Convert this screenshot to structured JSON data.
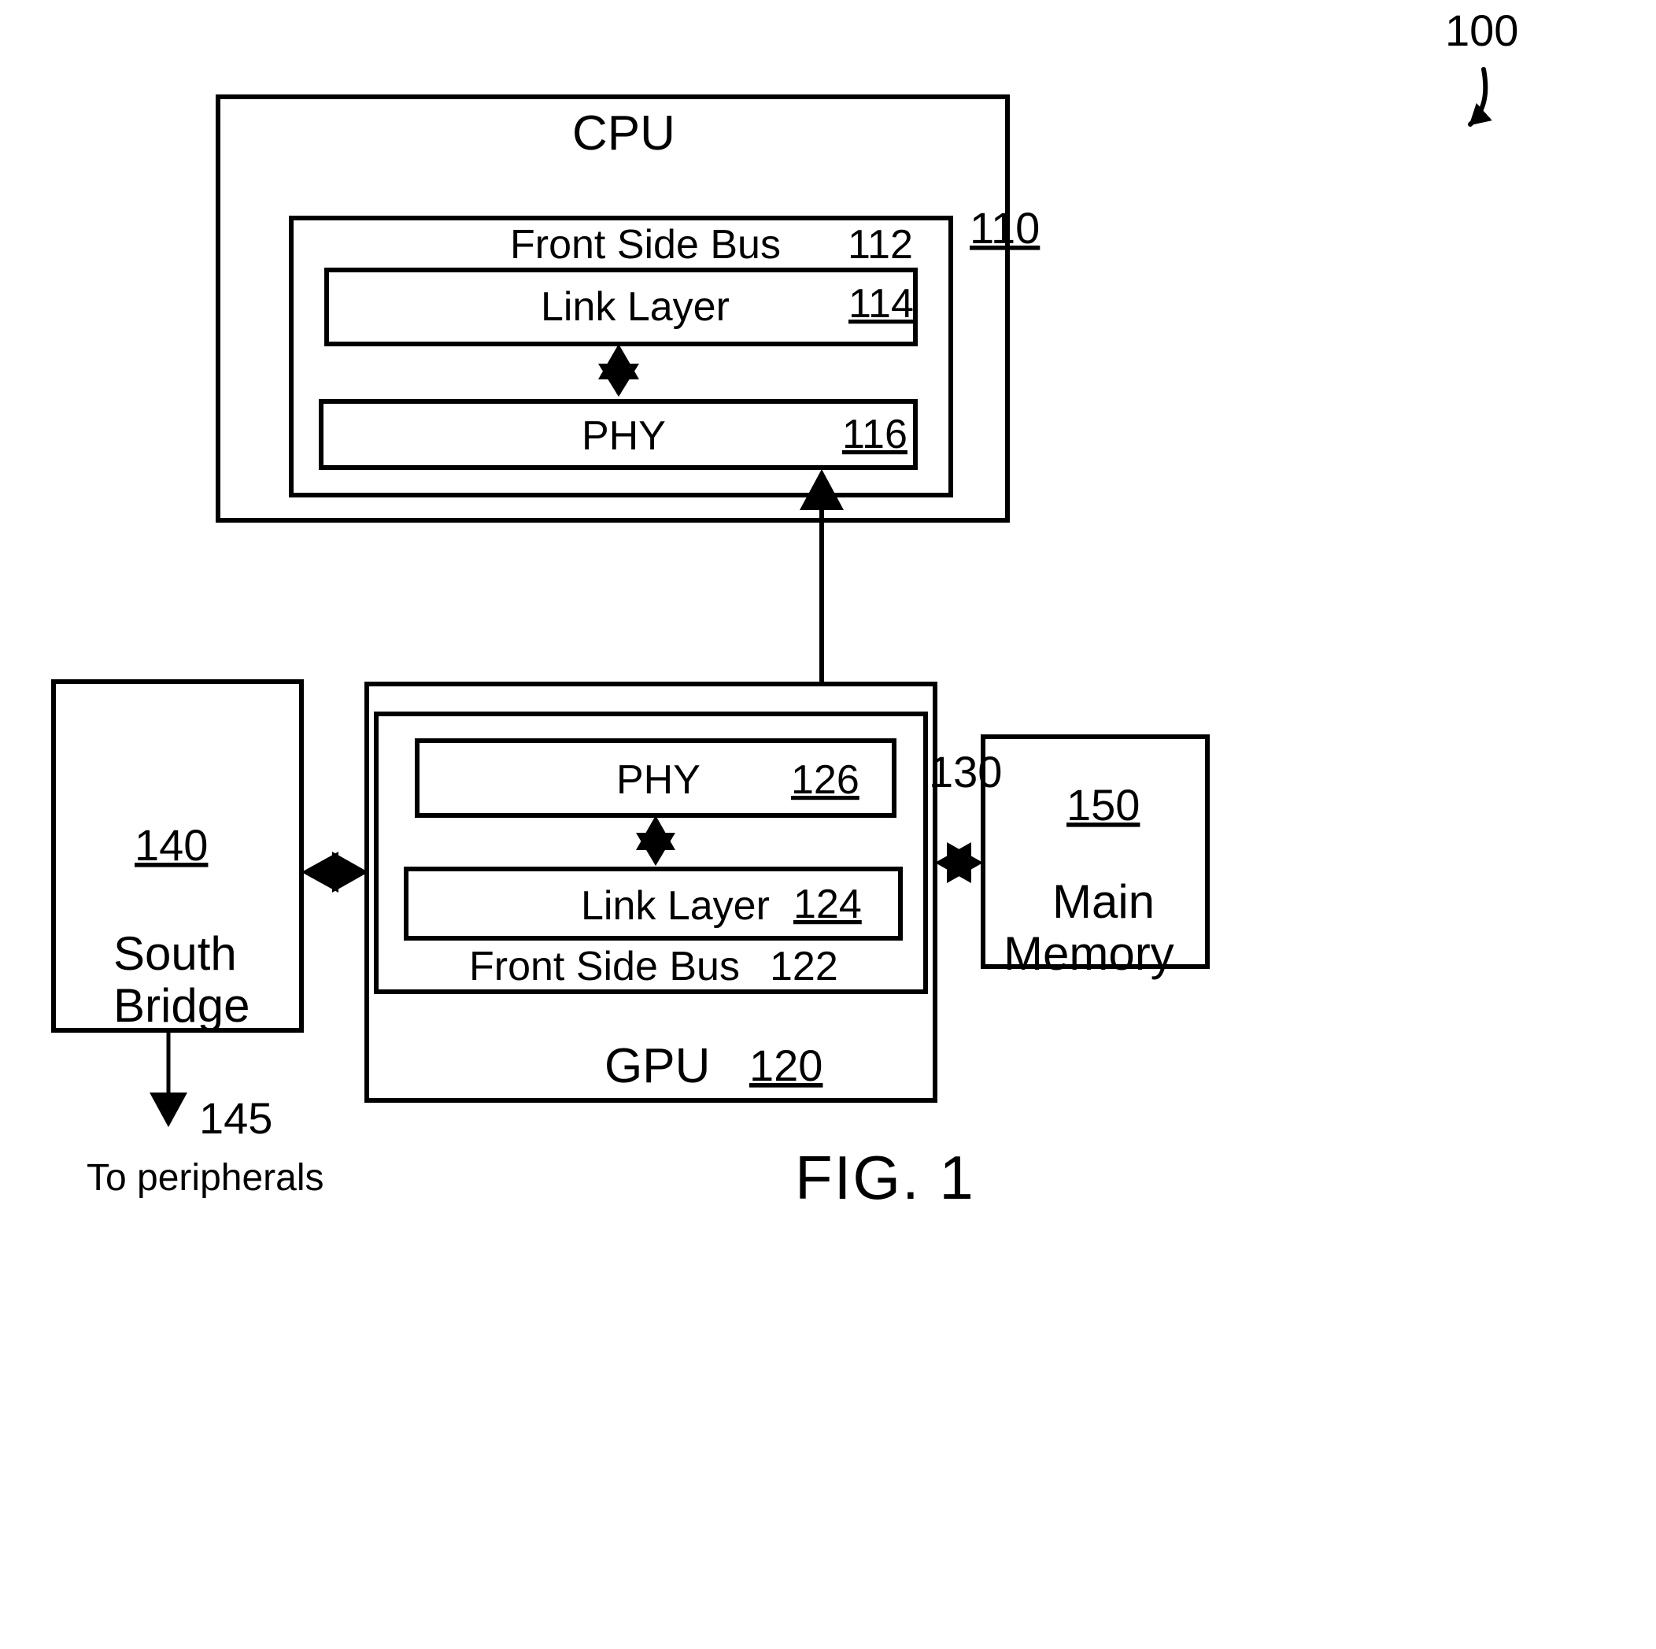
{
  "figure": {
    "caption": "FIG. 1",
    "system_ref": "100"
  },
  "cpu": {
    "title": "CPU",
    "ref": "110",
    "front_side_bus": {
      "label": "Front Side Bus",
      "ref": "112"
    },
    "link_layer": {
      "label": "Link Layer",
      "ref": "114"
    },
    "phy": {
      "label": "PHY",
      "ref": "116"
    }
  },
  "interconnect": {
    "ref": "130"
  },
  "gpu": {
    "title": "GPU",
    "ref": "120",
    "front_side_bus": {
      "label": "Front Side Bus",
      "ref": "122"
    },
    "link_layer": {
      "label": "Link Layer",
      "ref": "124"
    },
    "phy": {
      "label": "PHY",
      "ref": "126"
    }
  },
  "south_bridge": {
    "ref": "140",
    "line1": "South",
    "line2": "Bridge",
    "peripheral_link_ref": "145",
    "peripheral_label": "To peripherals"
  },
  "main_memory": {
    "ref": "150",
    "line1": "Main",
    "line2": "Memory"
  },
  "icons": {
    "bidirectional_arrow": "double-arrow-icon",
    "down_arrow": "down-arrow-icon",
    "curved_leader": "curved-leader-icon"
  }
}
